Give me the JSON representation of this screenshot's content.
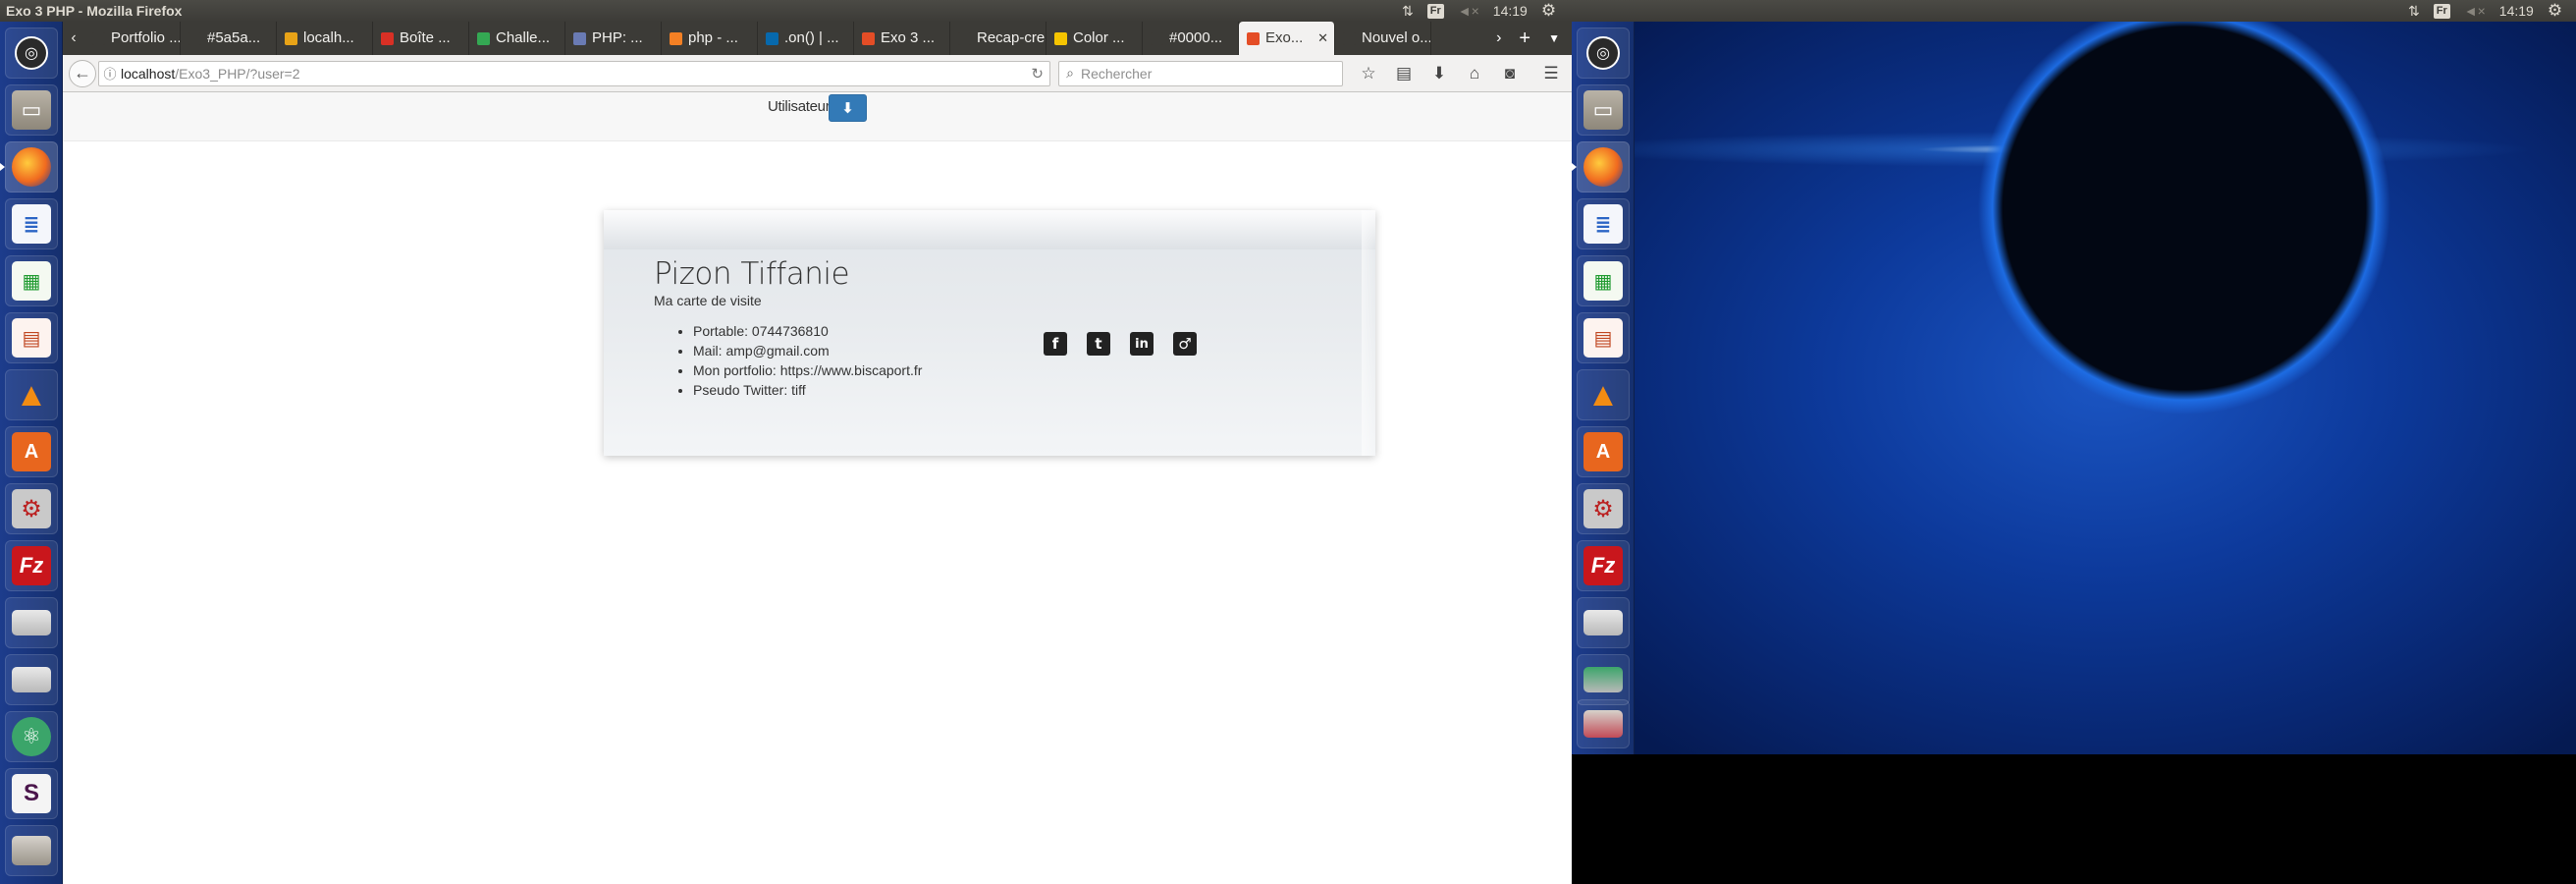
{
  "window": {
    "title": "Exo 3 PHP - Mozilla Firefox"
  },
  "panel": {
    "time": "14:19",
    "keyboard": "Fr"
  },
  "launcher": {
    "icons": [
      "ubuntu-dash-icon",
      "files-icon",
      "firefox-icon",
      "writer-icon",
      "calc-icon",
      "impress-icon",
      "vlc-icon",
      "software-center-icon",
      "system-settings-icon",
      "filezilla-icon",
      "drive-icon",
      "drive-icon",
      "atom-icon",
      "slack-icon",
      "trash-icon"
    ]
  },
  "tabs": [
    {
      "label": "Portfolio ...",
      "favicon_color": "#3c3b37"
    },
    {
      "label": "#5a5a...",
      "favicon_color": "#3c3b37"
    },
    {
      "label": "localh...",
      "favicon_color": "#e8a317"
    },
    {
      "label": "Boîte ...",
      "favicon_color": "#d93025"
    },
    {
      "label": "Challe...",
      "favicon_color": "#34a853"
    },
    {
      "label": "PHP: ...",
      "favicon_color": "#6a7bb4"
    },
    {
      "label": "php - ...",
      "favicon_color": "#f48024"
    },
    {
      "label": ".on() | ...",
      "favicon_color": "#0769ad"
    },
    {
      "label": "Exo 3 ...",
      "favicon_color": "#e44d26"
    },
    {
      "label": "Recap-crea",
      "favicon_color": "#3c3b37"
    },
    {
      "label": "Color ...",
      "favicon_color": "#f5c400"
    },
    {
      "label": "#0000...",
      "favicon_color": "#3c3b37"
    },
    {
      "label": "Exo...",
      "favicon_color": "#e44d26",
      "active": true
    },
    {
      "label": "Nouvel o...",
      "favicon_color": "#3c3b37"
    }
  ],
  "nav": {
    "url_host": "localhost",
    "url_path": "/Exo3_PHP/?user=2",
    "search_placeholder": "Rechercher"
  },
  "page": {
    "filter_label": "Utilisateur",
    "card": {
      "name": "Pizon Tiffanie",
      "subtitle": "Ma carte de visite",
      "items": [
        "Portable: 0744736810",
        "Mail: amp@gmail.com",
        "Mon portfolio: https://www.biscaport.fr",
        "Pseudo Twitter: tiff"
      ],
      "social": [
        "facebook-icon",
        "twitter-icon",
        "linkedin-icon",
        "gender-icon"
      ]
    }
  }
}
